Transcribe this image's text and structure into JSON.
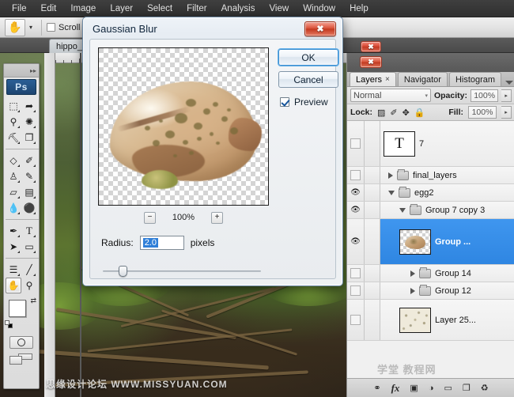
{
  "menubar": {
    "items": [
      "File",
      "Edit",
      "Image",
      "Layer",
      "Select",
      "Filter",
      "Analysis",
      "View",
      "Window",
      "Help"
    ]
  },
  "options_bar": {
    "current_tool_icon": "hand-tool-icon",
    "scroll_label": "Scroll",
    "dropdown_caret": "▾"
  },
  "document": {
    "tab_label": "hippo_t",
    "close_glyph": "✖"
  },
  "toolbar": {
    "app_badge": "Ps",
    "collapse_glyph": "▸▸",
    "tools": [
      {
        "name": "marquee-tool",
        "glyph": "⬚"
      },
      {
        "name": "move-tool",
        "glyph": "↖"
      },
      {
        "name": "lasso-tool",
        "glyph": "⚲"
      },
      {
        "name": "magic-wand-tool",
        "glyph": "✲"
      },
      {
        "name": "crop-tool",
        "glyph": "⛏"
      },
      {
        "name": "slice-tool",
        "glyph": "✂"
      },
      {
        "name": "healing-brush-tool",
        "glyph": "◇"
      },
      {
        "name": "brush-tool",
        "glyph": "✐"
      },
      {
        "name": "clone-stamp-tool",
        "glyph": "♟"
      },
      {
        "name": "history-brush-tool",
        "glyph": "✎"
      },
      {
        "name": "eraser-tool",
        "glyph": "▱"
      },
      {
        "name": "gradient-tool",
        "glyph": "▤"
      },
      {
        "name": "blur-tool",
        "glyph": "●"
      },
      {
        "name": "dodge-tool",
        "glyph": "⚲"
      },
      {
        "name": "pen-tool",
        "glyph": "✒"
      },
      {
        "name": "type-tool",
        "glyph": "T"
      },
      {
        "name": "path-selection-tool",
        "glyph": "▲"
      },
      {
        "name": "shape-tool",
        "glyph": "▭"
      },
      {
        "name": "notes-tool",
        "glyph": "☰"
      },
      {
        "name": "eyedropper-tool",
        "glyph": "╱"
      },
      {
        "name": "hand-tool",
        "glyph": "✋"
      },
      {
        "name": "zoom-tool",
        "glyph": "⚲"
      }
    ],
    "foreground_color": "#ffffff",
    "background_color": "#000000",
    "swap_glyph": "⇄",
    "quickmask_name": "quick-mask-mode",
    "screenmode_name": "screen-mode-toggle"
  },
  "dialog": {
    "title": "Gaussian Blur",
    "close_glyph": "✖",
    "ok_label": "OK",
    "cancel_label": "Cancel",
    "preview_label": "Preview",
    "preview_checked": true,
    "zoom_out_glyph": "−",
    "zoom_in_glyph": "+",
    "zoom_level": "100%",
    "radius_label": "Radius:",
    "radius_value": "2.0",
    "radius_units": "pixels",
    "slider_position_pct": 10
  },
  "right_dock": {
    "close_glyph": "✖",
    "tabs": [
      {
        "label": "Layers",
        "active": true,
        "closable": true,
        "close_glyph": "×"
      },
      {
        "label": "Navigator",
        "active": false,
        "closable": false
      },
      {
        "label": "Histogram",
        "active": false,
        "closable": false
      }
    ],
    "blend_mode": "Normal",
    "blend_caret": "▾",
    "opacity_label": "Opacity:",
    "opacity_value": "100%",
    "fill_label": "Fill:",
    "fill_value": "100%",
    "lock_label": "Lock:",
    "lock_icons": [
      {
        "name": "lock-transparency-icon",
        "glyph": "▨"
      },
      {
        "name": "lock-image-pixels-icon",
        "glyph": "✐"
      },
      {
        "name": "lock-position-icon",
        "glyph": "✥"
      },
      {
        "name": "lock-all-icon",
        "glyph": "ὑ2"
      }
    ],
    "opacity_caret": "▸",
    "fill_caret": "▸",
    "panel_menu_name": "panel-menu-icon",
    "layers": [
      {
        "name": "7",
        "type": "text",
        "visible": false,
        "indent": 0,
        "expand": null,
        "thumb": "T",
        "selected": false
      },
      {
        "name": "final_layers",
        "type": "group",
        "visible": false,
        "indent": 0,
        "expand": "collapsed",
        "selected": false
      },
      {
        "name": "egg2",
        "type": "group",
        "visible": true,
        "indent": 0,
        "expand": "expanded",
        "selected": false
      },
      {
        "name": "Group 7 copy 3",
        "type": "group",
        "visible": true,
        "indent": 1,
        "expand": "expanded",
        "selected": false
      },
      {
        "name": "Group ...",
        "type": "image",
        "visible": true,
        "indent": 2,
        "expand": null,
        "thumb": "egg",
        "selected": true
      },
      {
        "name": "Group 14",
        "type": "group",
        "visible": false,
        "indent": 2,
        "expand": "collapsed",
        "selected": false
      },
      {
        "name": "Group 12",
        "type": "group",
        "visible": false,
        "indent": 2,
        "expand": "collapsed",
        "selected": false
      },
      {
        "name": "Layer 25...",
        "type": "image",
        "visible": false,
        "indent": 2,
        "thumb": "speck",
        "selected": false
      }
    ],
    "footer_icons": [
      {
        "name": "link-layers-icon",
        "glyph": "⚭"
      },
      {
        "name": "layer-style-fx-icon",
        "glyph": "fx"
      },
      {
        "name": "add-layer-mask-icon",
        "glyph": "▣"
      },
      {
        "name": "new-fill-adjustment-icon",
        "glyph": "◑"
      },
      {
        "name": "new-group-icon",
        "glyph": "▭"
      },
      {
        "name": "new-layer-icon",
        "glyph": "❐"
      },
      {
        "name": "delete-layer-icon",
        "glyph": "Ὕ1"
      }
    ]
  },
  "watermarks": {
    "canvas": "思缘设计论坛  WWW.MISSYUAN.COM",
    "panel": "学堂 教程网"
  },
  "colors": {
    "accent_blue": "#2f86e2",
    "dialog_border": "#6d8aa5",
    "close_red": "#c43a20"
  }
}
